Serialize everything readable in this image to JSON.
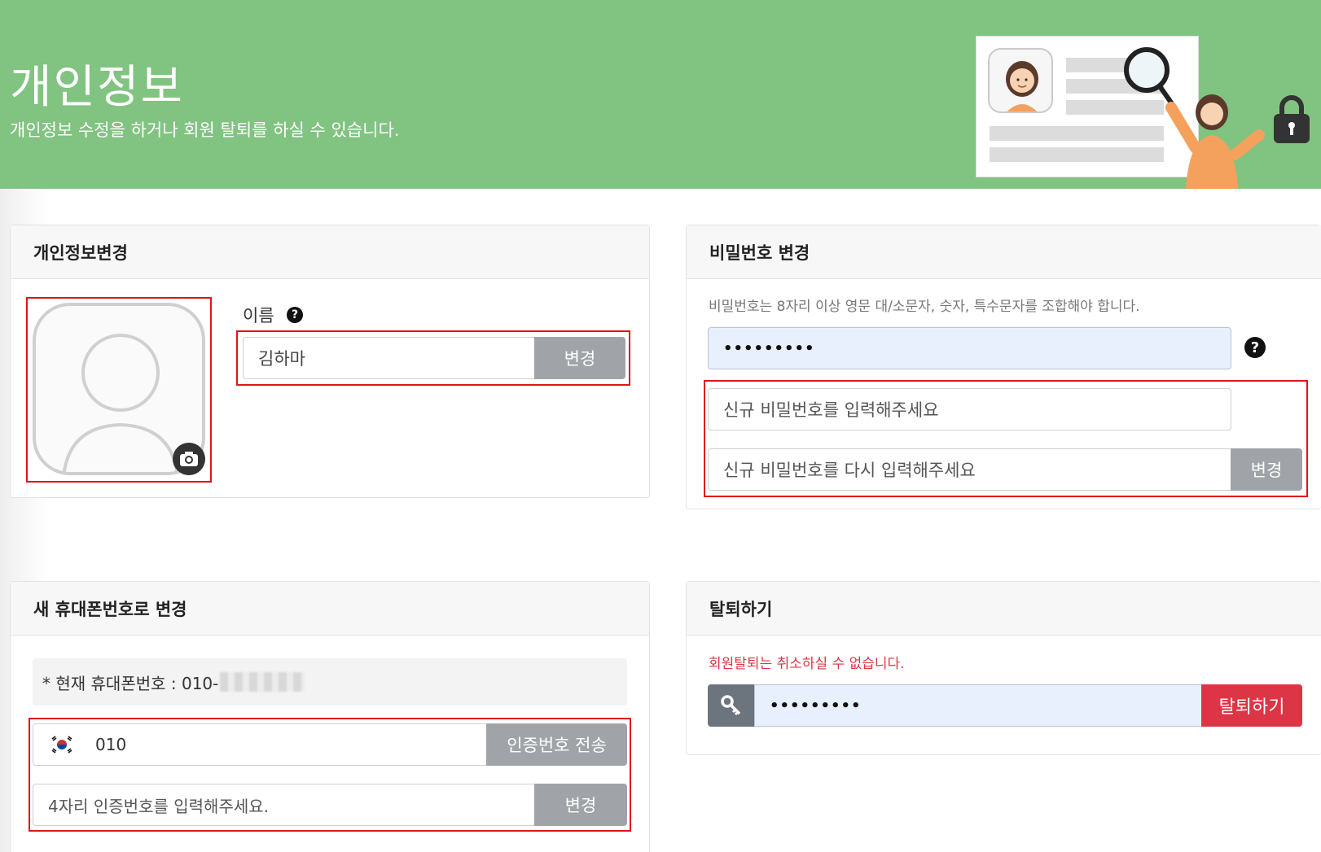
{
  "header": {
    "title": "개인정보",
    "subtitle": "개인정보 수정을 하거나 회원 탈퇴를 하실 수 있습니다."
  },
  "profile_panel": {
    "title": "개인정보변경",
    "name_label": "이름",
    "name_value": "김하마",
    "change_button": "변경"
  },
  "password_panel": {
    "title": "비밀번호 변경",
    "hint": "비밀번호는 8자리 이상 영문 대/소문자, 숫자, 특수문자를 조합해야 합니다.",
    "current_password": "•••••••••",
    "new_password_placeholder": "신규 비밀번호를 입력해주세요",
    "confirm_password_placeholder": "신규 비밀번호를 다시 입력해주세요",
    "change_button": "변경"
  },
  "phone_panel": {
    "title": "새 휴대폰번호로 변경",
    "current_label": "* 현재 휴대폰번호 : 010-",
    "phone_value": "010",
    "send_code_button": "인증번호 전송",
    "code_placeholder": "4자리 인증번호를 입력해주세요.",
    "change_button": "변경"
  },
  "withdraw_panel": {
    "title": "탈퇴하기",
    "warning": "회원탈퇴는 취소하실 수 없습니다.",
    "password": "•••••••••",
    "withdraw_button": "탈퇴하기"
  },
  "colors": {
    "header_bg": "#81c381",
    "highlight_border": "#e0141a",
    "danger": "#dc3545",
    "button_gray": "#a0a4a8"
  },
  "icons": [
    "help-icon",
    "camera-icon",
    "key-icon",
    "korea-flag-icon",
    "person-placeholder-icon",
    "magnifier-icon",
    "lock-icon"
  ]
}
